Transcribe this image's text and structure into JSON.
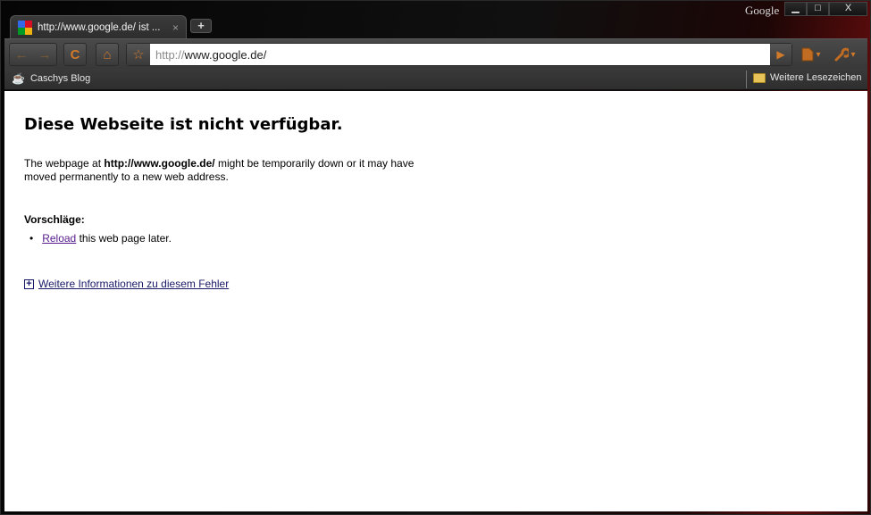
{
  "window": {
    "brand": "Google",
    "controls": {
      "minimize": "▁",
      "maximize": "□",
      "close": "X"
    }
  },
  "tabs": [
    {
      "title": "http://www.google.de/ ist ...",
      "close": "×"
    }
  ],
  "newtab_label": "+",
  "toolbar": {
    "back_icon": "←",
    "forward_icon": "→",
    "reload_icon": "C",
    "home_icon": "⌂",
    "star_icon": "☆",
    "url_scheme": "http://",
    "url_rest": "www.google.de/",
    "go_icon": "▶",
    "page_menu_icon": "▾",
    "wrench_menu_icon": "▾"
  },
  "bookmarks": {
    "items": [
      {
        "label": "Caschys Blog"
      }
    ],
    "other": "Weitere Lesezeichen"
  },
  "page": {
    "title": "Diese Webseite ist nicht verfügbar.",
    "desc_prefix": "The webpage at ",
    "desc_url": "http://www.google.de/",
    "desc_suffix": " might be temporarily down or it may have moved permanently to a new web address.",
    "suggestions_heading": "Vorschläge:",
    "suggestion_link": "Reload",
    "suggestion_rest": " this web page later.",
    "more_info": "Weitere Informationen zu diesem Fehler"
  },
  "colors": {
    "accent_orange": "#d07a2a",
    "visited_link": "#551a8b",
    "link": "#1a1a6a"
  }
}
